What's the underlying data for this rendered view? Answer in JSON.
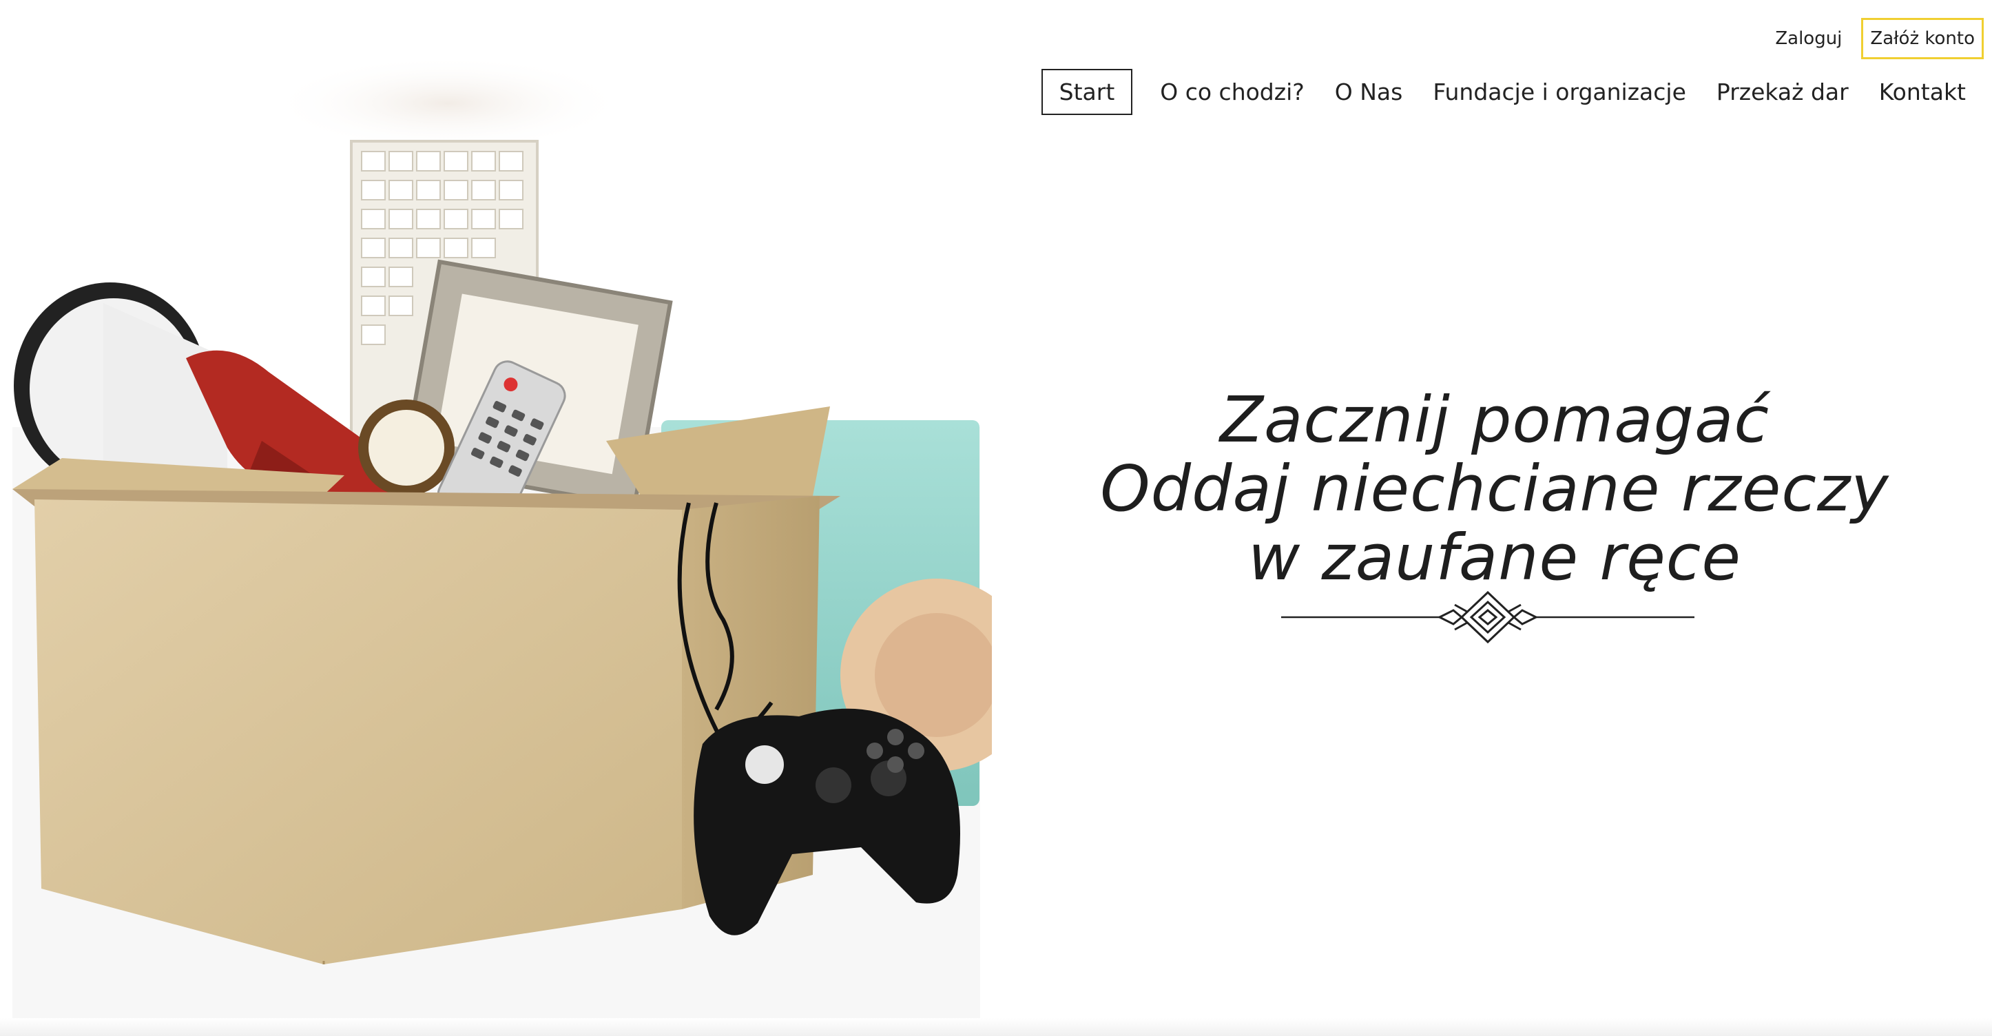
{
  "auth": {
    "login_label": "Zaloguj",
    "register_label": "Załóż konto",
    "register_border_color": "#F0CF31"
  },
  "nav": {
    "items": [
      {
        "label": "Start",
        "active": true
      },
      {
        "label": "O co chodzi?"
      },
      {
        "label": "O Nas"
      },
      {
        "label": "Fundacje i organizacje"
      },
      {
        "label": "Przekaż dar"
      },
      {
        "label": "Kontakt"
      }
    ]
  },
  "hero": {
    "headline_line1": "Zacznij pomagać",
    "headline_line2": "Oddaj niechciane rzeczy",
    "headline_line3": "w zaufane ręce",
    "image_icon": "donation-box-photo",
    "decoration_icon": "ornament-divider-icon"
  }
}
